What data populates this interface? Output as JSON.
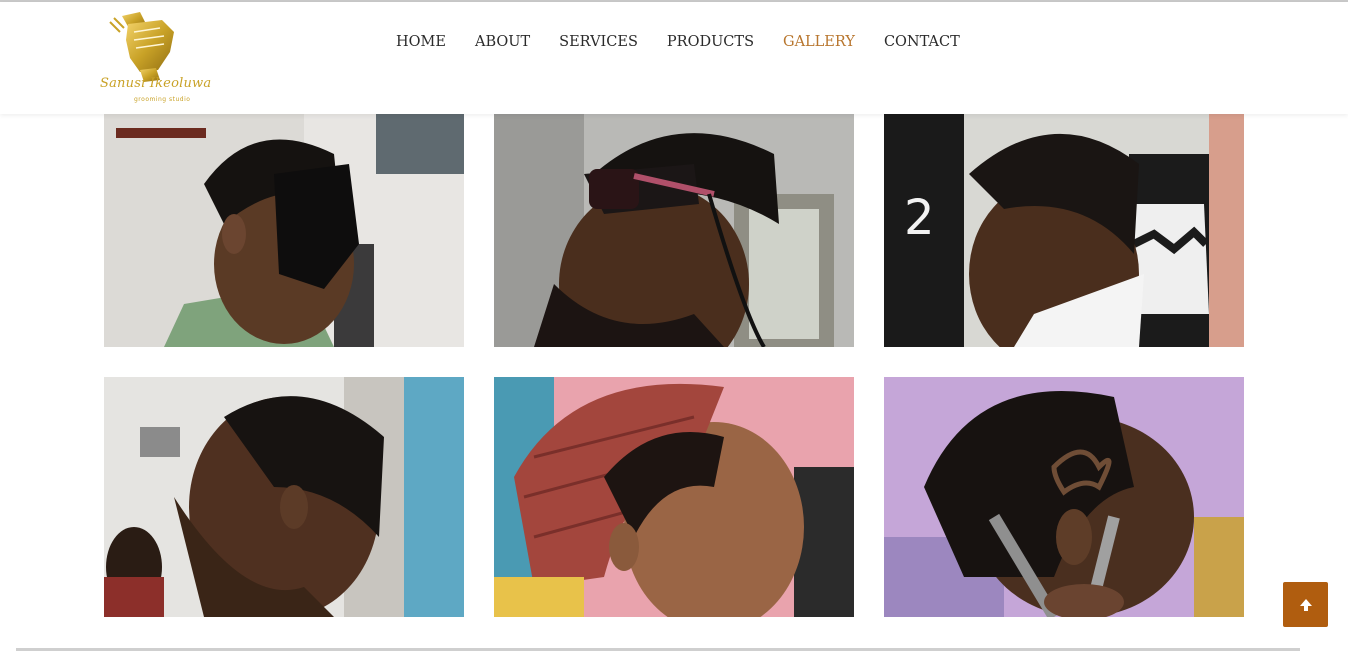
{
  "brand": {
    "name": "Sanusi Ikeoluwa",
    "tagline": "grooming studio",
    "gold": "#c9a227"
  },
  "nav": {
    "items": [
      {
        "label": "HOME",
        "active": false
      },
      {
        "label": "ABOUT",
        "active": false
      },
      {
        "label": "SERVICES",
        "active": false
      },
      {
        "label": "PRODUCTS",
        "active": false
      },
      {
        "label": "GALLERY",
        "active": true
      },
      {
        "label": "CONTACT",
        "active": false
      }
    ],
    "active_color": "#b8762e"
  },
  "gallery": {
    "photos": [
      {
        "subject": "man in black face mask"
      },
      {
        "subject": "man with sunglasses and fade"
      },
      {
        "subject": "man with short afro"
      },
      {
        "subject": "man with sharp line-up"
      },
      {
        "subject": "man with towel and fade"
      },
      {
        "subject": "man with hair design being shaved"
      }
    ]
  },
  "back_to_top": {
    "icon": "arrow-up-icon",
    "color": "#b05d0f"
  }
}
